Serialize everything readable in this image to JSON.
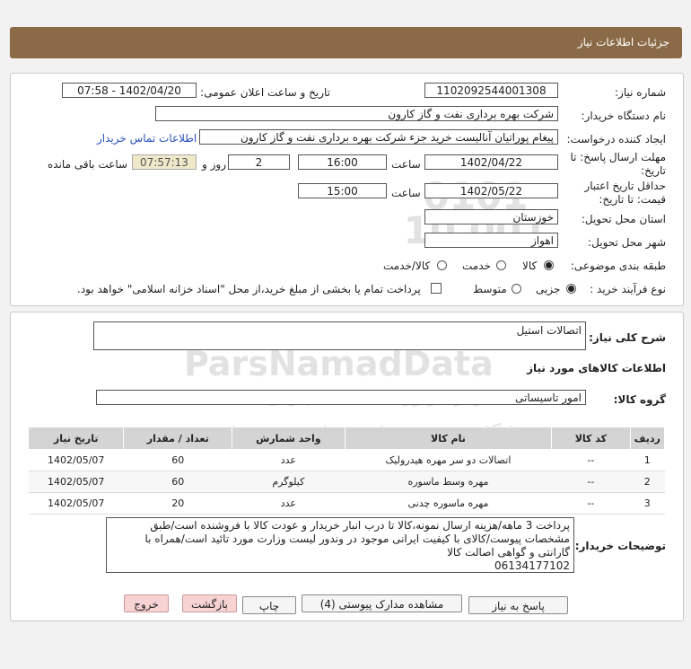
{
  "header": {
    "title": "جزئیات اطلاعات نیاز"
  },
  "form": {
    "need_number_label": "شماره نیاز:",
    "need_number": "1102092544001308",
    "announce_label": "تاریخ و ساعت اعلان عمومی:",
    "announce_value": "1402/04/20 - 07:58",
    "buyer_label": "نام دستگاه خریدار:",
    "buyer_value": "شرکت بهره برداری نفت و گاز کارون",
    "creator_label": "ایجاد کننده درخواست:",
    "creator_value": "پیغام پوراتیان آنالیست خرید جزء شرکت بهره برداری نفت و گاز کارون",
    "contact_link": "اطلاعات تماس خریدار",
    "deadline_label_1": "مهلت ارسال پاسخ: تا",
    "deadline_label_2": "تاریخ:",
    "deadline_date": "1402/04/22",
    "time_word": "ساعت",
    "deadline_time": "16:00",
    "days_value": "2",
    "days_and": "روز و",
    "remaining_time": "07:57:13",
    "remaining_label": "ساعت باقی مانده",
    "validity_label_1": "حداقل تاریخ اعتبار",
    "validity_label_2": "قیمت: تا تاریخ:",
    "validity_date": "1402/05/22",
    "validity_time": "15:00",
    "province_label": "استان محل تحویل:",
    "province_value": "خوزستان",
    "city_label": "شهر محل تحویل:",
    "city_value": "اهواز",
    "category_label": "طبقه بندی موضوعی:",
    "category_options": [
      "کالا",
      "خدمت",
      "کالا/خدمت"
    ],
    "category_selected": "کالا",
    "process_label": "نوع فرآیند خرید :",
    "process_options": [
      "جزیی",
      "متوسط"
    ],
    "process_selected": "جزیی",
    "payment_text": "پرداخت تمام یا بخشی از مبلغ خرید،از محل \"اسناد خزانه اسلامی\" خواهد بود."
  },
  "summary": {
    "label": "شرح کلی نیاز:",
    "value": "اتصالات استیل",
    "items_title": "اطلاعات کالاهای مورد نیاز",
    "group_label": "گروه کالا:",
    "group_value": "امور تاسیساتی"
  },
  "table": {
    "headers": [
      "ردیف",
      "کد کالا",
      "نام کالا",
      "واحد شمارش",
      "تعداد / مقدار",
      "تاریخ نیاز"
    ],
    "rows": [
      [
        "1",
        "--",
        "اتصالات دو سر مهره هیدرولیک",
        "عدد",
        "60",
        "1402/05/07"
      ],
      [
        "2",
        "--",
        "مهره وسط ماسوره",
        "کیلوگرم",
        "60",
        "1402/05/07"
      ],
      [
        "3",
        "--",
        "مهره ماسوره چدنی",
        "عدد",
        "20",
        "1402/05/07"
      ]
    ]
  },
  "buyer_notes": {
    "label": "توضیحات خریدار:",
    "text": "پرداخت 3 ماهه/هزینه ارسال نمونه،کالا تا درب انبار خریدار و عودت کالا با فروشنده است/طبق مشخصات پیوست/کالای با کیفیت ایرانی موجود در وندور لیست وزارت مورد تائید است/همراه با گارانتی و گواهی اصالت کالا\n06134177102"
  },
  "buttons": {
    "reply": "پاسخ به نیاز",
    "attachments": "مشاهده مدارک پیوستی (4)",
    "print": "چاپ",
    "back": "بازگشت",
    "exit": "خروج"
  },
  "watermark": {
    "brand": "ParsNamadData",
    "line1": "مرکز فراوری اطلاعات پارس نماد داده",
    "line2": "پایگاه خبری رسانی مناقصه و مزایده",
    "phone": "021-88349670-5",
    "digits": "0101 001 10"
  }
}
